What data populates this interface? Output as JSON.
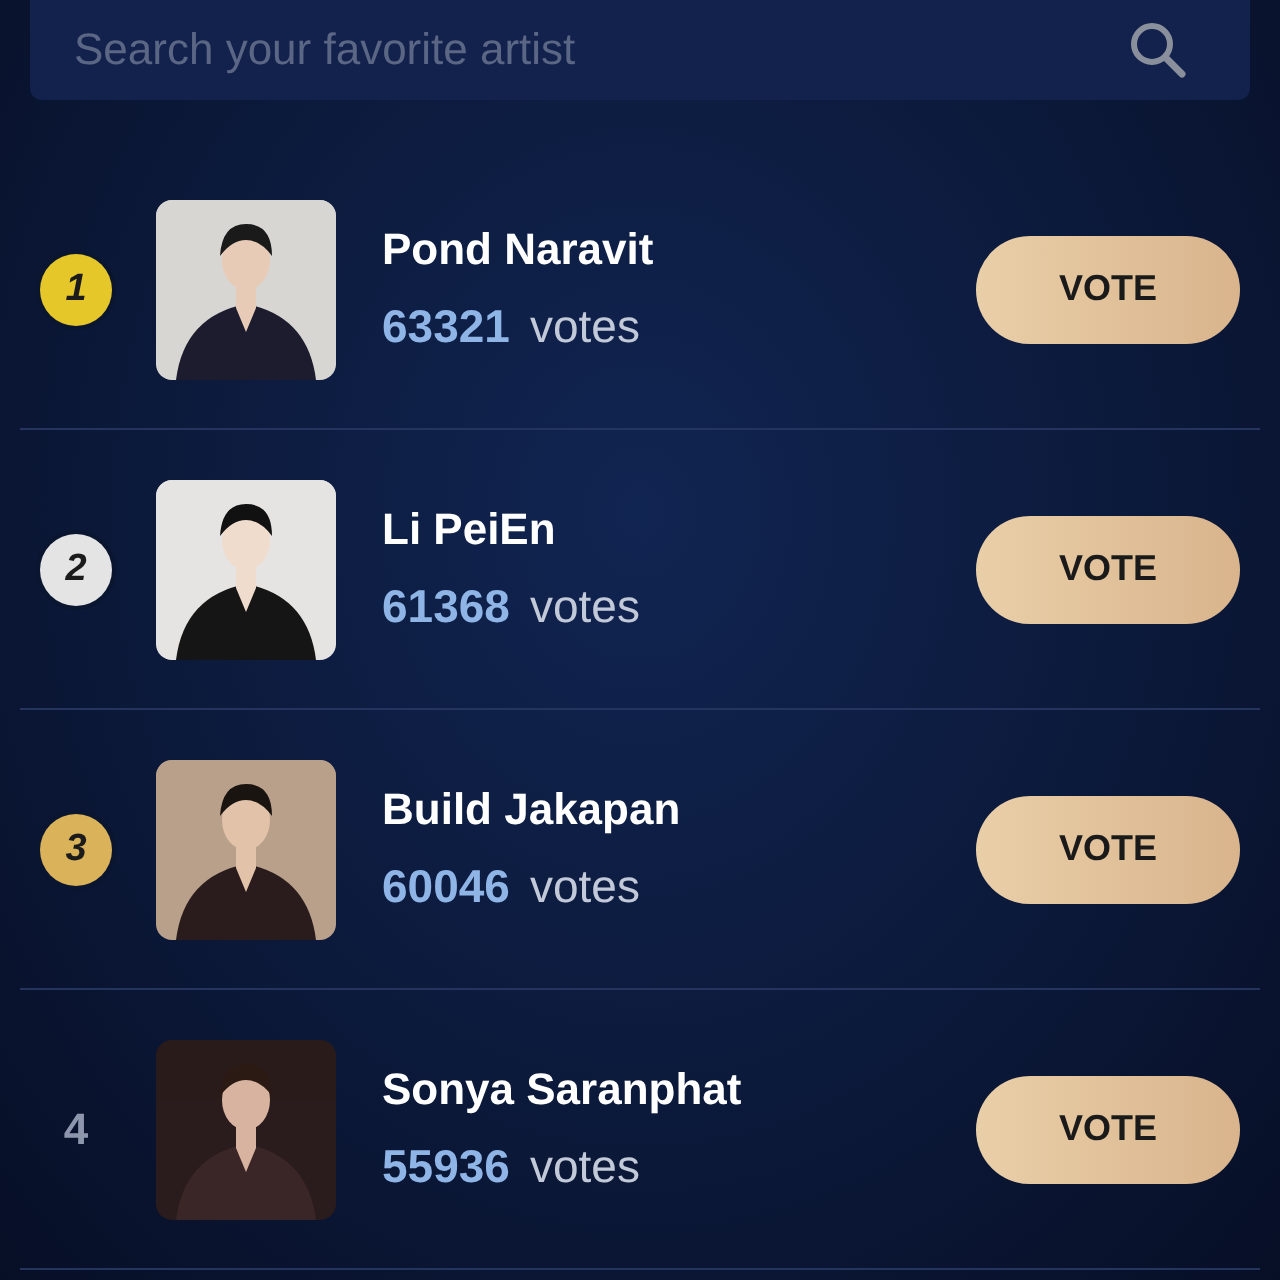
{
  "search": {
    "placeholder": "Search your favorite artist"
  },
  "artists": [
    {
      "rank": "1",
      "kind": "medal",
      "color": "#e6c72a",
      "name": "Pond Naravit",
      "votes": "63321",
      "votes_label": "votes",
      "button": "VOTE"
    },
    {
      "rank": "2",
      "kind": "medal",
      "color": "#e4e4e4",
      "name": "Li PeiEn",
      "votes": "61368",
      "votes_label": "votes",
      "button": "VOTE"
    },
    {
      "rank": "3",
      "kind": "medal",
      "color": "#d9b25a",
      "name": "Build Jakapan",
      "votes": "60046",
      "votes_label": "votes",
      "button": "VOTE"
    },
    {
      "rank": "4",
      "kind": "plain",
      "name": "Sonya Saranphat",
      "votes": "55936",
      "votes_label": "votes",
      "button": "VOTE"
    }
  ]
}
